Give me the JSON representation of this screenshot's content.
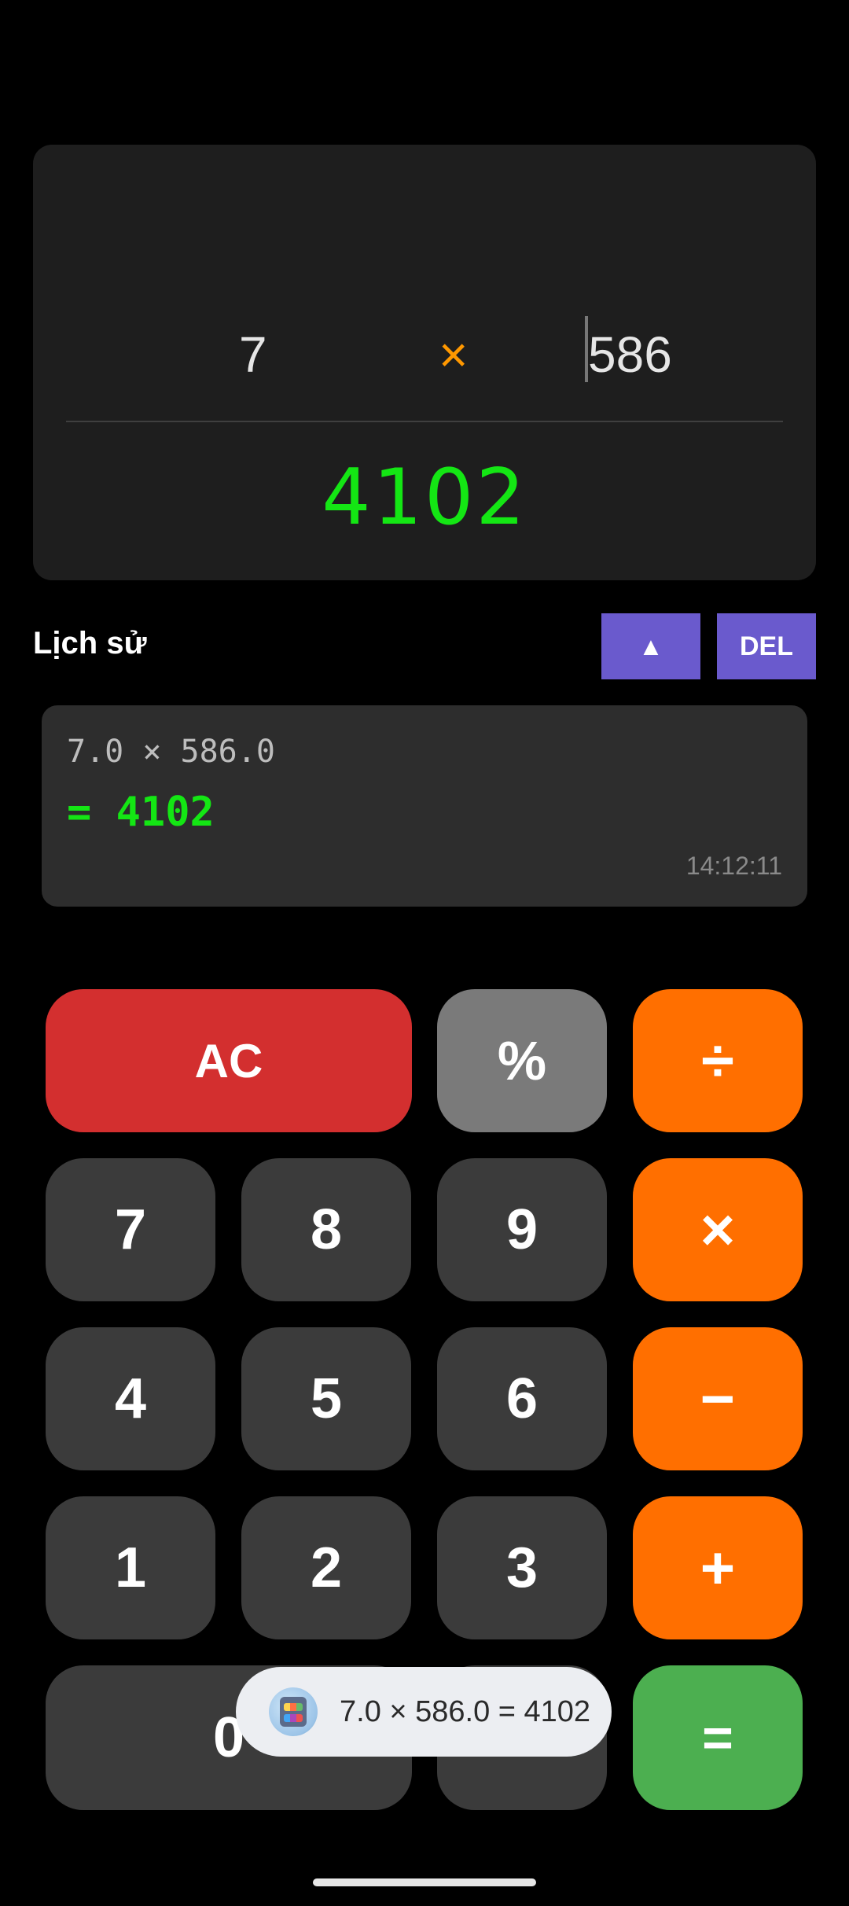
{
  "display": {
    "left_operand": "7",
    "operator": "×",
    "right_operand": "586",
    "result": "4102"
  },
  "history": {
    "title": "Lịch sử",
    "up_button": "▲",
    "del_button": "DEL",
    "entries": [
      {
        "expression": "7.0 × 586.0",
        "result": "=  4102",
        "time": "14:12:11"
      }
    ]
  },
  "keypad": {
    "ac": "AC",
    "percent": "%",
    "divide": "÷",
    "seven": "7",
    "eight": "8",
    "nine": "9",
    "multiply": "×",
    "four": "4",
    "five": "5",
    "six": "6",
    "minus": "−",
    "one": "1",
    "two": "2",
    "three": "3",
    "plus": "+",
    "zero": "0",
    "dot": ".",
    "equals": "="
  },
  "toast": {
    "icon": "calculator-robot-icon",
    "text": "7.0 × 586.0 = 4102"
  },
  "colors": {
    "result_green": "#14e614",
    "operator_orange": "#ff9800",
    "ac_red": "#d32f2f",
    "op_orange": "#ff6f00",
    "equals_green": "#4caf50",
    "accent_purple": "#6a5acd"
  }
}
